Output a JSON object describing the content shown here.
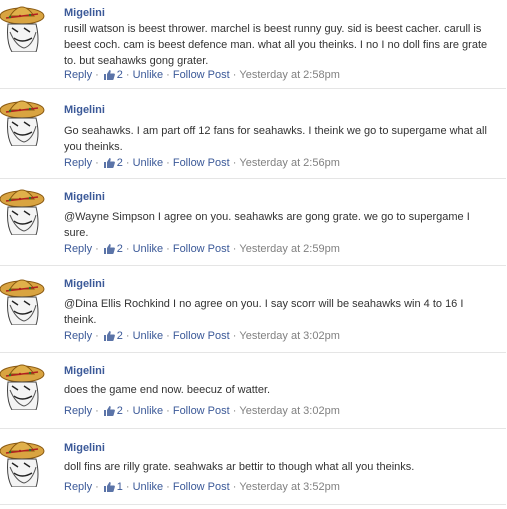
{
  "comments": [
    {
      "author": "Migelini",
      "text": "rusill watson is beest thrower. marchel is beest runny guy. sid is beest cacher. carull is beest coch. cam is beest defence man. what all you theinks. I no I no doll fins are grate to. but seahawks gong grater.",
      "reply": "Reply",
      "like_count": "2",
      "unlike": "Unlike",
      "follow": "Follow Post",
      "time": "Yesterday at 2:58pm"
    },
    {
      "author": "Migelini",
      "text": "Go seahawks. I am part off 12 fans for seahawks. I theink we go to supergame what all you theinks.",
      "reply": "Reply",
      "like_count": "2",
      "unlike": "Unlike",
      "follow": "Follow Post",
      "time": "Yesterday at 2:56pm"
    },
    {
      "author": "Migelini",
      "text": "@Wayne Simpson I agree on you. seahawks are gong grate. we go to supergame I sure.",
      "reply": "Reply",
      "like_count": "2",
      "unlike": "Unlike",
      "follow": "Follow Post",
      "time": "Yesterday at 2:59pm"
    },
    {
      "author": "Migelini",
      "text": "@Dina Ellis Rochkind I no agree on you. I say scorr will be seahawks win 4 to 16 I theink.",
      "reply": "Reply",
      "like_count": "2",
      "unlike": "Unlike",
      "follow": "Follow Post",
      "time": "Yesterday at 3:02pm"
    },
    {
      "author": "Migelini",
      "text": "does the game end now. beecuz of watter.",
      "reply": "Reply",
      "like_count": "2",
      "unlike": "Unlike",
      "follow": "Follow Post",
      "time": "Yesterday at 3:02pm"
    },
    {
      "author": "Migelini",
      "text": "doll fins are rilly grate. seahwaks ar bettir to though what all you theinks.",
      "reply": "Reply",
      "like_count": "1",
      "unlike": "Unlike",
      "follow": "Follow Post",
      "time": "Yesterday at 3:52pm"
    }
  ],
  "separator": "·",
  "icons": {
    "avatar": "sombrero-avatar-icon",
    "like": "thumbs-up-icon"
  },
  "colors": {
    "link": "#3b5998",
    "meta": "#808080",
    "text": "#333333",
    "divider": "#e5e5e5",
    "sombrero": "#d9a441",
    "sombrero_dark": "#8a5a12"
  }
}
